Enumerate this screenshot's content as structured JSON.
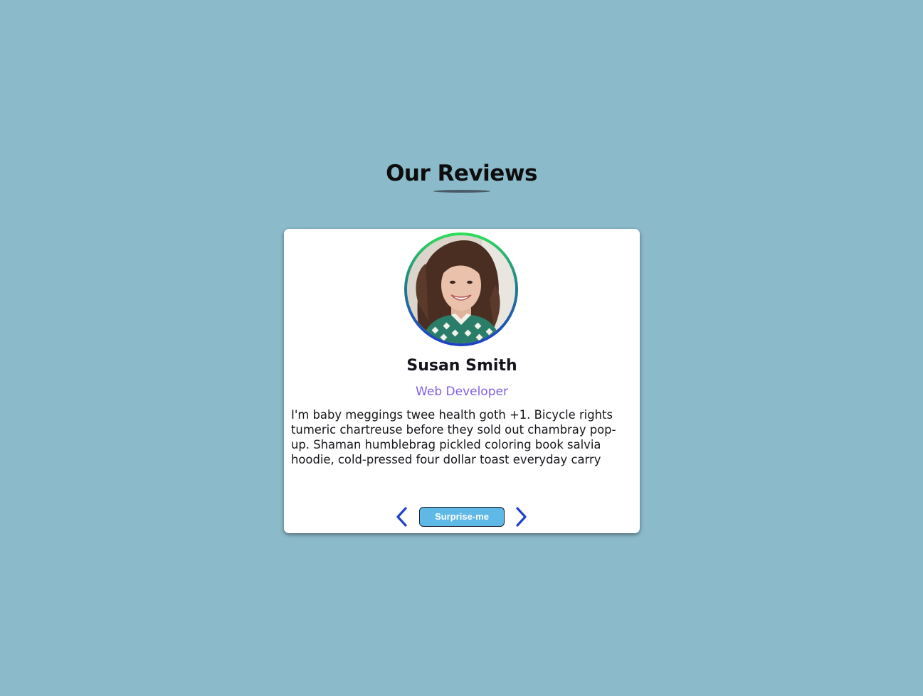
{
  "section": {
    "title": "Our Reviews"
  },
  "review": {
    "name": "Susan Smith",
    "job": "Web Developer",
    "text": "I'm baby meggings twee health goth +1. Bicycle rights tumeric chartreuse before they sold out chambray pop-up. Shaman humblebrag pickled coloring book salvia hoodie, cold-pressed four dollar toast everyday carry"
  },
  "controls": {
    "prev_icon": "chevron-left-icon",
    "next_icon": "chevron-right-icon",
    "surprise_label": "Surprise-me"
  },
  "colors": {
    "background": "#8bbbcb",
    "job": "#7f5fe8",
    "chevrons": "#1e3fc8",
    "surprise_button": "#5fb9e6"
  }
}
